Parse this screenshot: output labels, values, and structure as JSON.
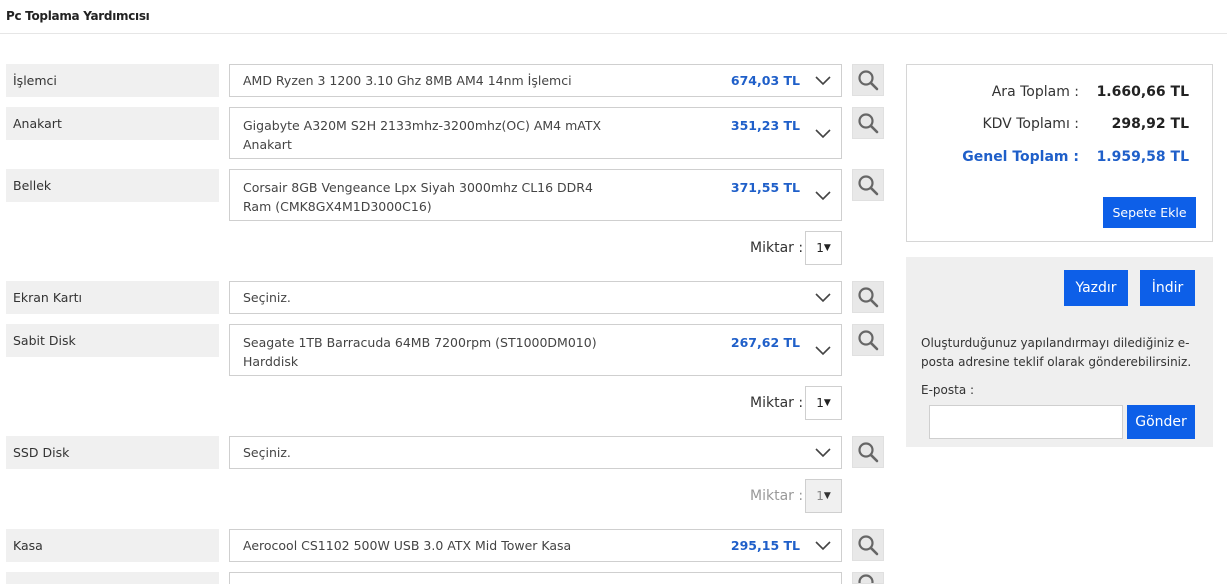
{
  "page": {
    "title": "Pc Toplama Yardımcısı"
  },
  "rows": [
    {
      "label": "İşlemci",
      "selected": "AMD Ryzen 3 1200 3.10 Ghz 8MB AM4 14nm İşlemci",
      "price": "674,03 TL"
    },
    {
      "label": "Anakart",
      "selected": "Gigabyte A320M S2H 2133mhz-3200mhz(OC) AM4 mATX Anakart",
      "price": "351,23 TL"
    },
    {
      "label": "Bellek",
      "selected": "Corsair 8GB Vengeance Lpx Siyah 3000mhz CL16 DDR4 Ram (CMK8GX4M1D3000C16)",
      "price": "371,55 TL",
      "qty_label": "Miktar :",
      "qty_value": "1"
    },
    {
      "label": "Ekran Kartı",
      "selected": "Seçiniz.",
      "price": ""
    },
    {
      "label": "Sabit Disk",
      "selected": "Seagate 1TB Barracuda 64MB 7200rpm (ST1000DM010) Harddisk",
      "price": "267,62 TL",
      "qty_label": "Miktar :",
      "qty_value": "1"
    },
    {
      "label": "SSD Disk",
      "selected": "Seçiniz.",
      "price": "",
      "qty_label": "Miktar :",
      "qty_value": "1"
    },
    {
      "label": "Kasa",
      "selected": "Aerocool CS1102 500W USB 3.0 ATX Mid Tower Kasa",
      "price": "295,15 TL"
    }
  ],
  "summary": {
    "subtotal_label": "Ara Toplam :",
    "subtotal_value": "1.660,66 TL",
    "vat_label": "KDV Toplamı :",
    "vat_value": "298,92 TL",
    "total_label": "Genel Toplam :",
    "total_value": "1.959,58 TL",
    "add_to_cart": "Sepete Ekle"
  },
  "side": {
    "print_button": "Yazdır",
    "download_button": "İndir",
    "info_text": "Oluşturduğunuz yapılandırmayı dilediğiniz e-posta adresine teklif olarak gönderebilirsiniz.",
    "email_label": "E-posta :",
    "email_value": "",
    "send_button": "Gönder"
  },
  "colors": {
    "accent": "#0d5fe8",
    "price": "#1f5fc9",
    "label_bg": "#f0f0f0",
    "panel_bg": "#efefef"
  }
}
